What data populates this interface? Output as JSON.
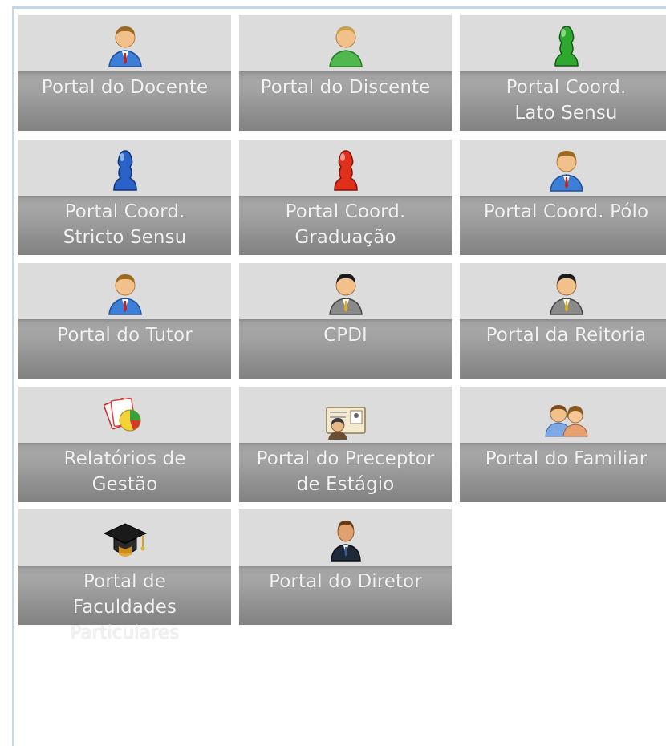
{
  "portals": [
    {
      "label": "Portal do Docente",
      "icon": "teacher-icon"
    },
    {
      "label": "Portal do Discente",
      "icon": "student-icon"
    },
    {
      "label": "Portal Coord.\nLato Sensu",
      "icon": "green-pawn-icon"
    },
    {
      "label": "Portal Coord.\nStricto Sensu",
      "icon": "blue-pawn-icon"
    },
    {
      "label": "Portal Coord.\nGraduação",
      "icon": "red-pawn-icon"
    },
    {
      "label": "Portal Coord. Pólo",
      "icon": "coordinator-icon"
    },
    {
      "label": "Portal do Tutor",
      "icon": "tutor-icon"
    },
    {
      "label": "CPDI",
      "icon": "executive-icon"
    },
    {
      "label": "Portal da Reitoria",
      "icon": "executive-icon"
    },
    {
      "label": "Relatórios de\nGestão",
      "icon": "reports-chart-icon"
    },
    {
      "label": "Portal do Preceptor\nde Estágio",
      "icon": "id-card-icon"
    },
    {
      "label": "Portal do Familiar",
      "icon": "family-icon"
    },
    {
      "label": "Portal de\nFaculdades\nParticulares",
      "icon": "graduation-cap-icon"
    },
    {
      "label": "Portal do Diretor",
      "icon": "director-icon"
    }
  ],
  "colors": {
    "tile_bg": "#dcdcdc",
    "band": "#9a9a9a",
    "label_text": "#f2f2f2",
    "frame_border": "#c7d5ea"
  }
}
